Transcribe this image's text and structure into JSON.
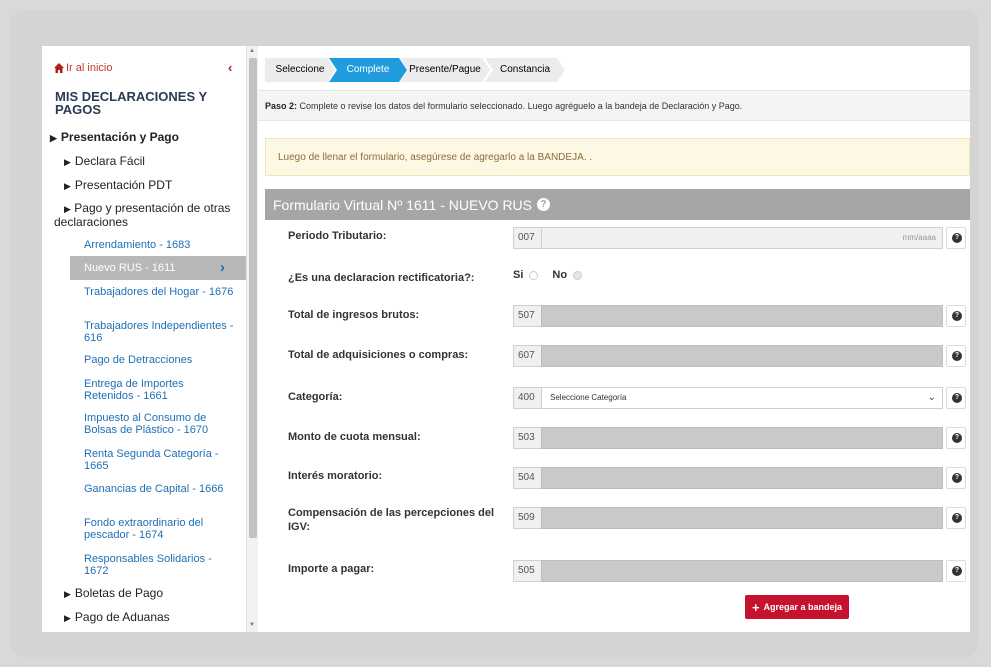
{
  "sidebar": {
    "home_link": "Ir al inicio",
    "title": "MIS DECLARACIONES Y PAGOS",
    "section": "Presentación y Pago",
    "items": [
      {
        "label": "Declara Fácil"
      },
      {
        "label": "Presentación PDT"
      },
      {
        "label": "Pago y presentación de otras declaraciones"
      }
    ],
    "sub_items": [
      {
        "label": "Arrendamiento - 1683"
      },
      {
        "label": "Nuevo RUS - 1611"
      },
      {
        "label": "Trabajadores del Hogar - 1676"
      },
      {
        "label": "Trabajadores Independientes - 616"
      },
      {
        "label": "Pago de Detracciones"
      },
      {
        "label": "Entrega de Importes Retenidos - 1661"
      },
      {
        "label": "Impuesto al Consumo de Bolsas de Plástico - 1670"
      },
      {
        "label": "Renta Segunda Categoría - 1665"
      },
      {
        "label": "Ganancias de Capital - 1666"
      },
      {
        "label": "Fondo extraordinario del pescador - 1674"
      },
      {
        "label": "Responsables Solidarios - 1672"
      }
    ],
    "bottom_items": [
      {
        "label": "Boletas de Pago"
      },
      {
        "label": "Pago de Aduanas"
      }
    ]
  },
  "steps": [
    {
      "label": "Seleccione",
      "active": false
    },
    {
      "label": "Complete",
      "active": true
    },
    {
      "label": "Presente/Pague",
      "active": false
    },
    {
      "label": "Constancia",
      "active": false
    }
  ],
  "instruction": {
    "prefix": "Paso 2:",
    "text": " Complete o revise los datos del formulario seleccionado. Luego agréguelo a la bandeja de Declaración y Pago."
  },
  "alert": "Luego de llenar el formulario, asegúrese de agregarlo a la BANDEJA. .",
  "form": {
    "title": "Formulario Virtual Nº 1611 - NUEVO RUS",
    "fields": [
      {
        "label": "Periodo Tributario:",
        "code": "007",
        "placeholder": "mm/aaaa"
      },
      {
        "label": "¿Es una declaracion rectificatoria?:",
        "options": [
          "Si",
          "No"
        ],
        "selected": "No"
      },
      {
        "label": "Total de ingresos brutos:",
        "code": "507"
      },
      {
        "label": "Total de adquisiciones o compras:",
        "code": "607"
      },
      {
        "label": "Categoría:",
        "code": "400",
        "select_value": "Seleccione Categoría"
      },
      {
        "label": "Monto de cuota mensual:",
        "code": "503"
      },
      {
        "label": "Interés moratorio:",
        "code": "504"
      },
      {
        "label": "Compensación de las percepciones del IGV:",
        "code": "509"
      },
      {
        "label": "Importe a pagar:",
        "code": "505"
      }
    ],
    "add_button": "Agregar a bandeja"
  },
  "colors": {
    "accent_blue": "#1f9bde",
    "link_blue": "#1f6fb6",
    "button_red": "#c4122f",
    "header_gray": "#a6a6a6",
    "alert_bg": "#fcf8e3"
  }
}
